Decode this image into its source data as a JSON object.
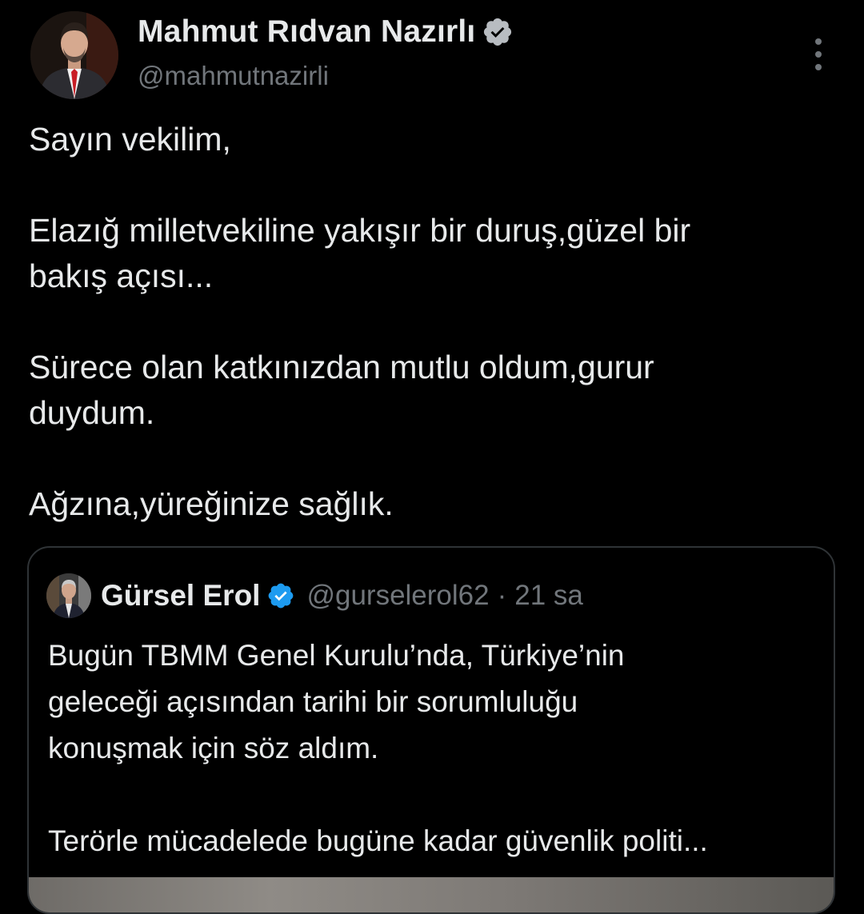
{
  "tweet": {
    "author": {
      "display_name": "Mahmut Rıdvan Nazırlı",
      "handle": "@mahmutnazirli",
      "verified": true,
      "avatar_icon": "profile-photo"
    },
    "more_icon": "more-vertical-icon",
    "text_lines": [
      "Sayın vekilim,",
      "",
      "Elazığ milletvekiline yakışır bir duruş,güzel bir",
      "bakış açısı...",
      "",
      "Sürece olan katkınızdan mutlu oldum,gurur",
      "duydum.",
      "",
      "Ağzına,yüreğinize sağlık."
    ]
  },
  "quote": {
    "author": {
      "display_name": "Gürsel Erol",
      "handle": "@gurselerol62",
      "separator": "·",
      "time": "21 sa",
      "verified": true,
      "avatar_icon": "profile-photo"
    },
    "text_lines": [
      "Bugün TBMM Genel Kurulu’nda, Türkiye’nin",
      "geleceği açısından tarihi bir sorumluluğu",
      "konuşmak için söz aldım.",
      "",
      "Terörle mücadelede bugüne kadar güvenlik politi..."
    ]
  },
  "colors": {
    "background": "#000000",
    "text_primary": "#e7e9ea",
    "text_secondary": "#71767b",
    "verified_badge": "#1d9bf0",
    "border": "#2f3336"
  }
}
